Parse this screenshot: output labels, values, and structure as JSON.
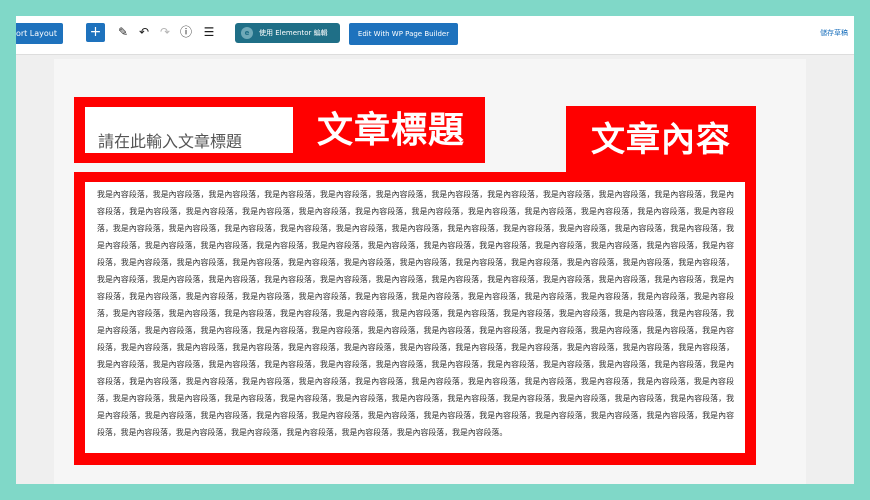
{
  "toolbar": {
    "import_layout_label": "Import Layout",
    "import_layout_visible": "port Layout",
    "add_block_icon": "plus-icon",
    "add_block_glyph": "+",
    "tools_icon": "pencil-icon",
    "tools_glyph": "✎",
    "undo_icon": "undo-icon",
    "undo_glyph": "↶",
    "redo_icon": "redo-icon",
    "redo_glyph": "↷",
    "details_icon": "info-icon",
    "details_glyph": "ⓘ",
    "outline_icon": "list-view-icon",
    "outline_glyph": "☰",
    "elementor_logo": "e",
    "elementor_label": "使用 Elementor 編輯",
    "wp_page_builder_label": "Edit With WP Page Builder",
    "save_draft_label": "儲存草稿"
  },
  "editor": {
    "title_placeholder": "請在此輸入文章標題",
    "content_text": "我是內容段落，我是內容段落，我是內容段落，我是內容段落，我是內容段落，我是內容段落，我是內容段落，我是內容段落，我是內容段落，我是內容段落，我是內容段落，我是內容段落，我是內容段落，我是內容段落，我是內容段落，我是內容段落，我是內容段落，我是內容段落，我是內容段落，我是內容段落，我是內容段落，我是內容段落，我是內容段落，我是內容段落，我是內容段落，我是內容段落，我是內容段落，我是內容段落，我是內容段落，我是內容段落，我是內容段落，我是內容段落，我是內容段落，我是內容段落，我是內容段落，我是內容段落，我是內容段落，我是內容段落，我是內容段落，我是內容段落，我是內容段落，我是內容段落，我是內容段落，我是內容段落，我是內容段落，我是內容段落，我是內容段落，我是內容段落，我是內容段落，我是內容段落，我是內容段落，我是內容段落，我是內容段落，我是內容段落，我是內容段落，我是內容段落，我是內容段落，我是內容段落，我是內容段落，我是內容段落，我是內容段落，我是內容段落，我是內容段落，我是內容段落，我是內容段落，我是內容段落，我是內容段落，我是內容段落，我是內容段落，我是內容段落，我是內容段落，我是內容段落，我是內容段落，我是內容段落，我是內容段落，我是內容段落，我是內容段落，我是內容段落，我是內容段落，我是內容段落，我是內容段落，我是內容段落，我是內容段落，我是內容段落，我是內容段落，我是內容段落，我是內容段落，我是內容段落，我是內容段落，我是內容段落，我是內容段落，我是內容段落，我是內容段落，我是內容段落，我是內容段落，我是內容段落，我是內容段落，我是內容段落，我是內容段落，我是內容段落，我是內容段落，我是內容段落，我是內容段落，我是內容段落，我是內容段落，我是內容段落，我是內容段落，我是內容段落，我是內容段落，我是內容段落，我是內容段落，我是內容段落，我是內容段落，我是內容段落，我是內容段落，我是內容段落，我是內容段落，我是內容段落，我是內容段落，我是內容段落，我是內容段落，我是內容段落，我是內容段落，我是內容段落，我是內容段落，我是內容段落，我是內容段落，我是內容段落，我是內容段落，我是內容段落，我是內容段落，我是內容段落，我是內容段落，我是內容段落，我是內容段落，我是內容段落，我是內容段落，我是內容段落，我是內容段落，我是內容段落，我是內容段落，我是內容段落，我是內容段落，我是內容段落，我是內容段落，我是內容段落，我是內容段落，我是內容段落，我是內容段落，我是內容段落，我是內容段落，我是內容段落，我是內容段落，我是內容段落，我是內容段落，我是內容段落，我是內容段落，我是內容段落，我是內容段落，我是內容段落，我是內容段落，我是內容段落，我是內容段落，我是內容段落，我是內容段落，我是內容段落，我是內容段落。"
  },
  "annotations": {
    "title_label": "文章標題",
    "content_label": "文章內容",
    "highlight_color": "#ff0000"
  },
  "colors": {
    "background": "#80d8c8",
    "primary_button": "#1e72bd",
    "elementor_button": "#1f6f87"
  }
}
